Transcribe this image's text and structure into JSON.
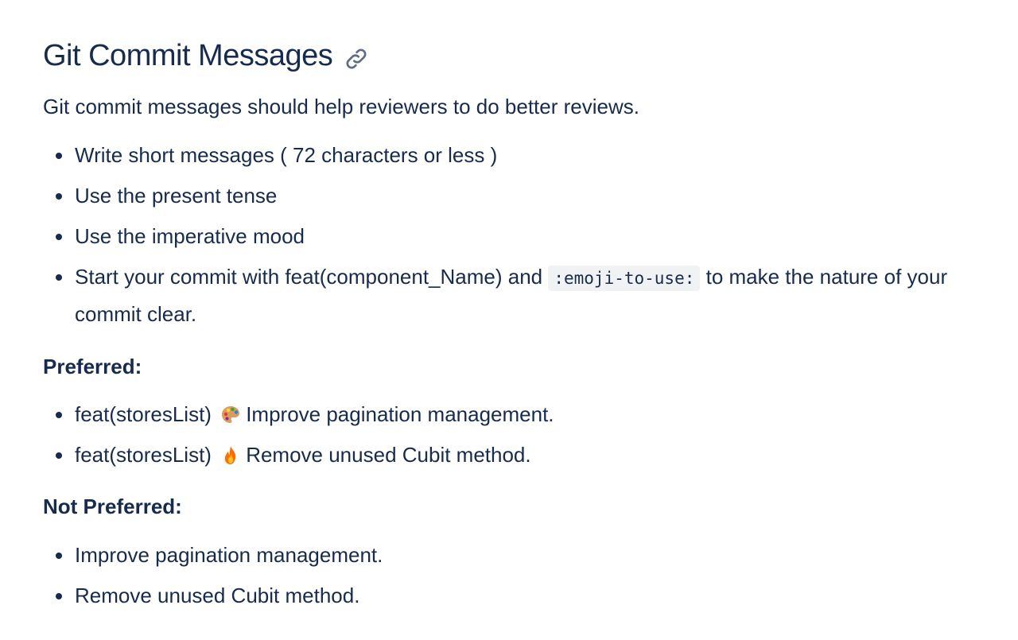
{
  "heading": {
    "title": "Git Commit Messages",
    "icon": "link-icon"
  },
  "intro": "Git commit messages should help reviewers to do better reviews.",
  "guidelines": [
    {
      "text": "Write short messages ( 72 characters or less )"
    },
    {
      "text": "Use the present tense"
    },
    {
      "text": "Use the imperative mood"
    },
    {
      "before": "Start your commit with feat(component_Name) and ",
      "code": ":emoji-to-use:",
      "after": " to make the nature of your commit clear."
    }
  ],
  "preferred": {
    "label": "Preferred:",
    "items": [
      {
        "prefix": "feat(storesList)",
        "emoji": "palette-icon",
        "text": "Improve pagination management."
      },
      {
        "prefix": "feat(storesList)",
        "emoji": "fire-icon",
        "text": "Remove unused Cubit method."
      }
    ]
  },
  "not_preferred": {
    "label": "Not Preferred:",
    "items": [
      {
        "text": "Improve pagination management."
      },
      {
        "text": "Remove unused Cubit method."
      }
    ]
  },
  "colors": {
    "text": "#172b4d",
    "code_background": "#f1f2f4"
  }
}
